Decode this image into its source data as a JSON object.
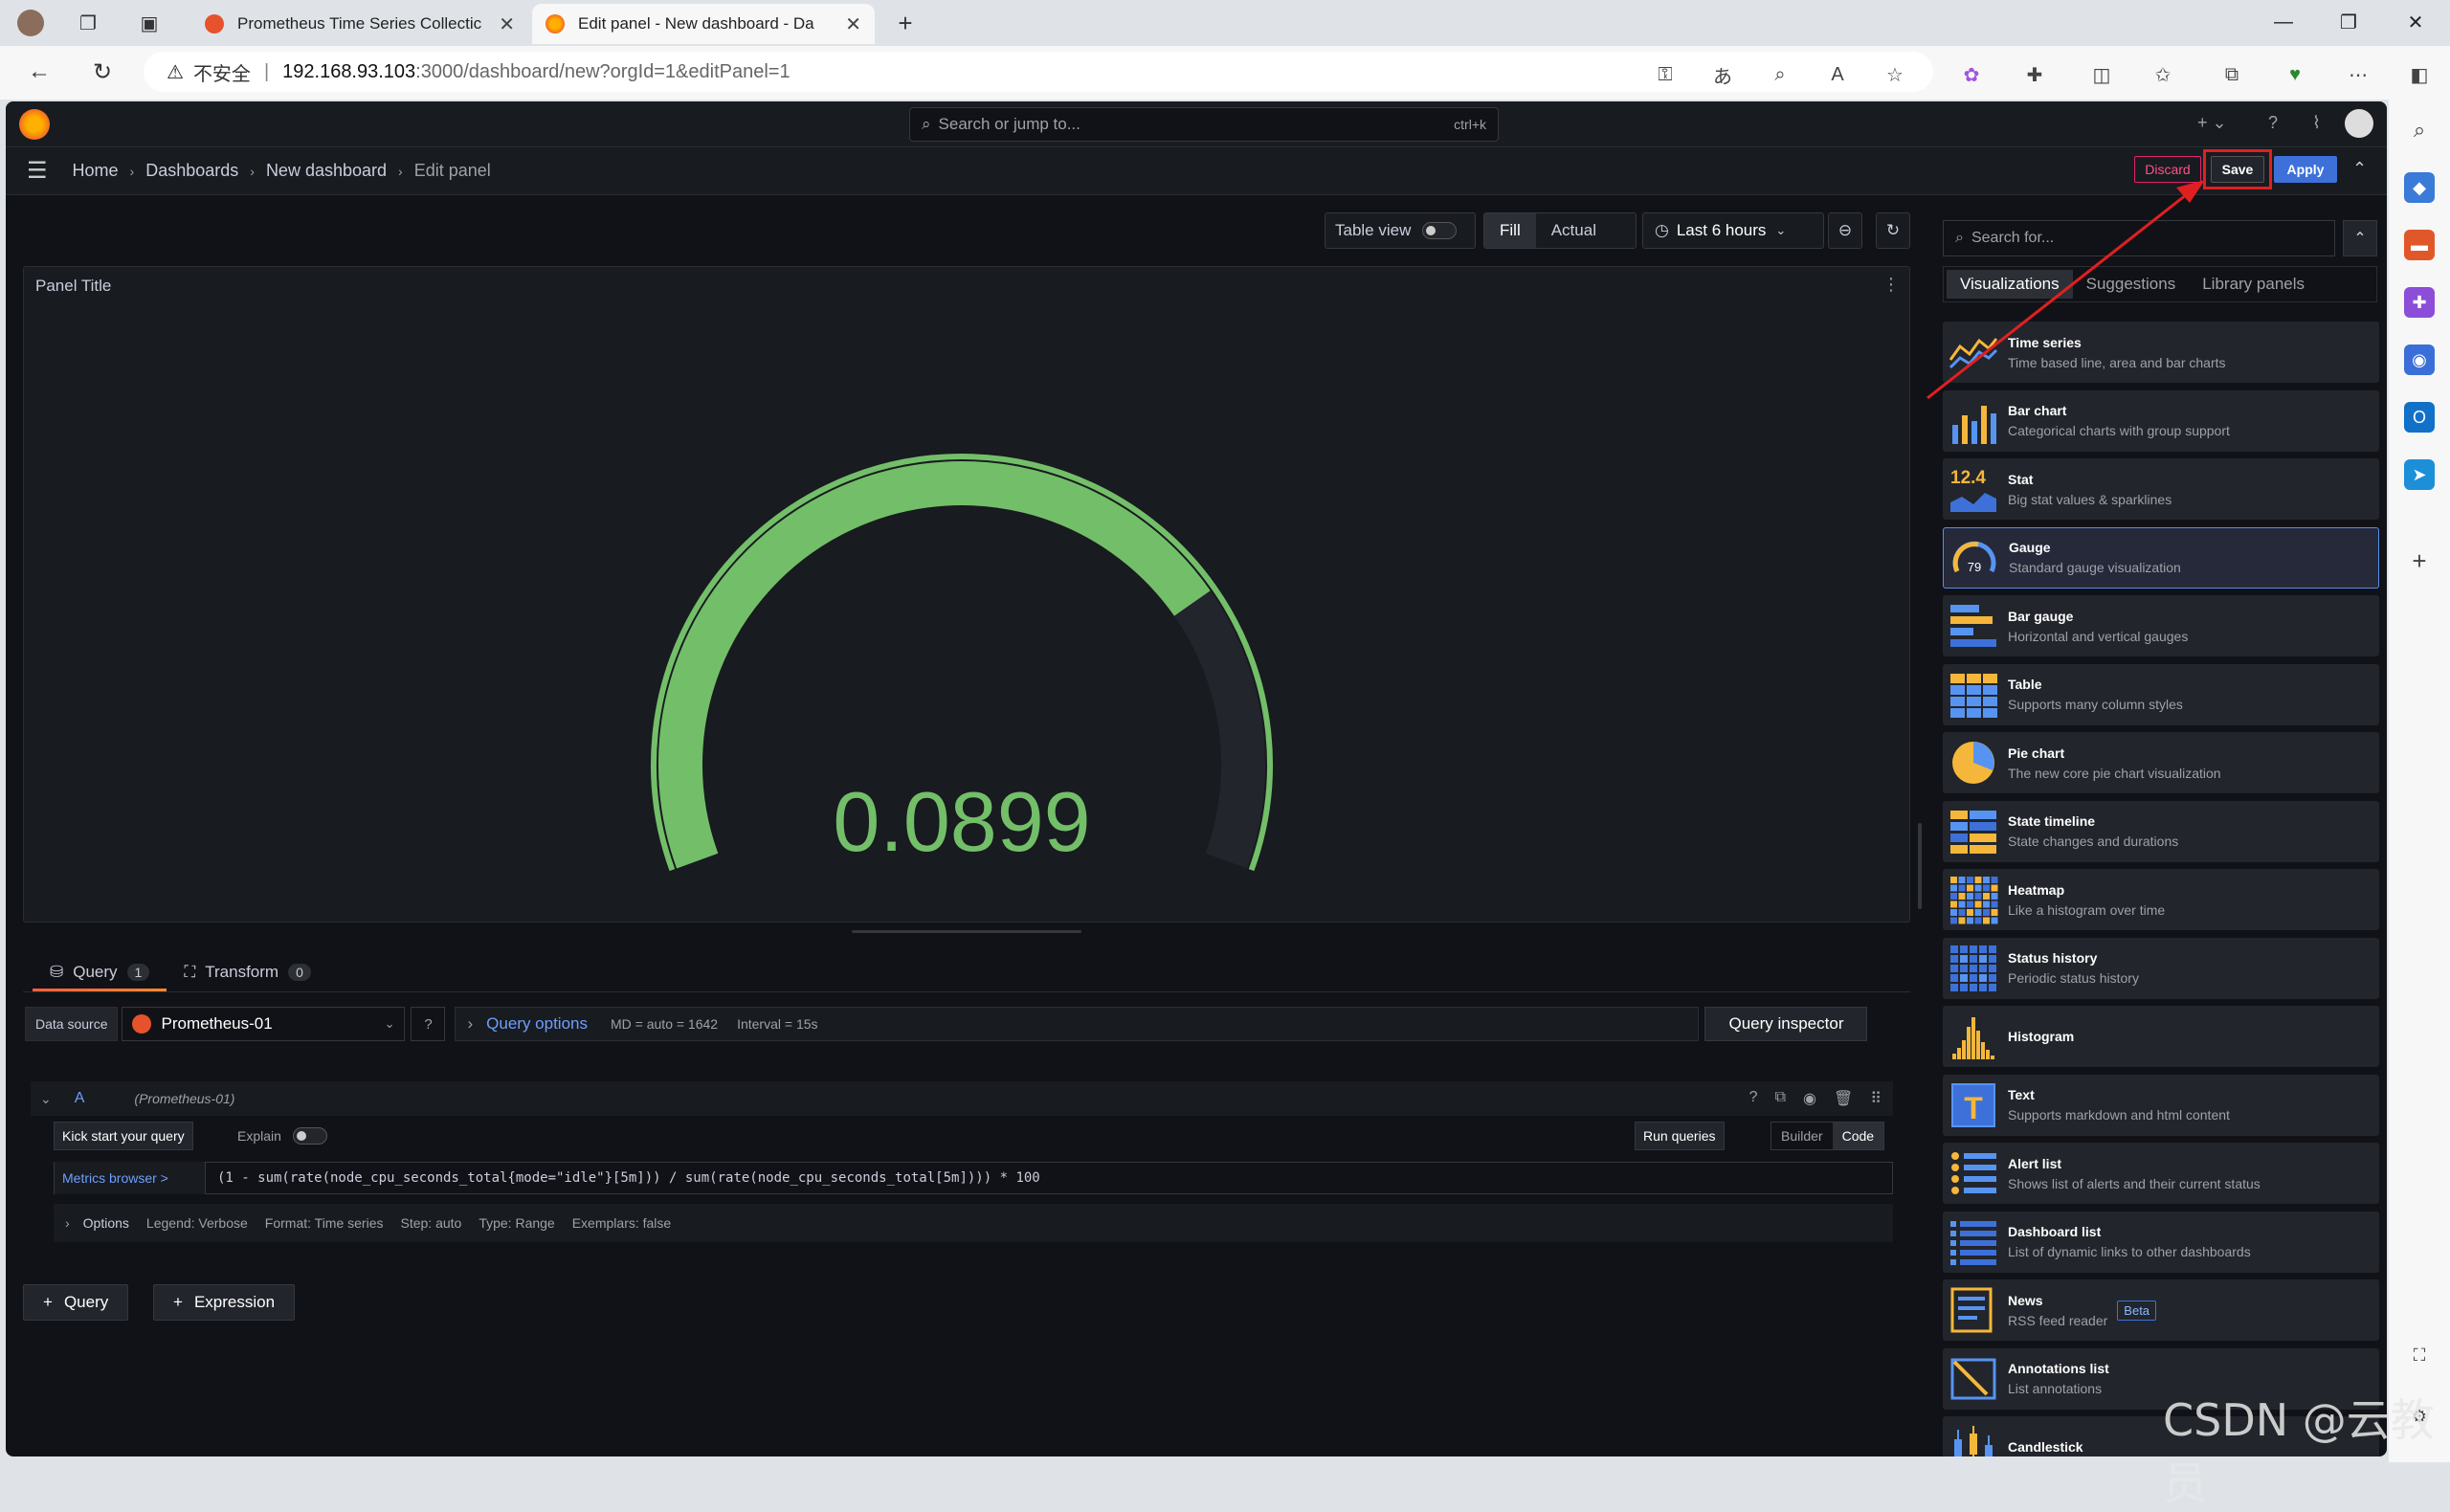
{
  "browser": {
    "tabs": [
      {
        "title": "Prometheus Time Series Collectic"
      },
      {
        "title": "Edit panel - New dashboard - Da"
      }
    ],
    "url": {
      "security": "不安全",
      "host": "192.168.93.103",
      "path": ":3000/dashboard/new?orgId=1&editPanel=1"
    }
  },
  "grafana": {
    "search": {
      "placeholder": "Search or jump to...",
      "shortcut": "ctrl+k"
    },
    "breadcrumb": [
      "Home",
      "Dashboards",
      "New dashboard",
      "Edit panel"
    ],
    "actions": {
      "discard": "Discard",
      "save": "Save",
      "apply": "Apply"
    },
    "toolbar": {
      "table_view": "Table view",
      "fill": "Fill",
      "actual": "Actual",
      "time_range": "Last 6 hours"
    },
    "panel": {
      "title": "Panel Title",
      "value": "0.0899",
      "gauge_fraction": 0.75,
      "gauge_color": "#73bf69"
    },
    "query_tabs": [
      {
        "label": "Query",
        "count": "1"
      },
      {
        "label": "Transform",
        "count": "0"
      }
    ],
    "datasource": {
      "label": "Data source",
      "name": "Prometheus-01"
    },
    "query_options": {
      "label": "Query options",
      "md": "MD = auto = 1642",
      "interval": "Interval = 15s",
      "inspector": "Query inspector"
    },
    "query_a": {
      "ref": "A",
      "ds": "(Prometheus-01)",
      "kick": "Kick start your query",
      "explain": "Explain",
      "run": "Run queries",
      "builder": "Builder",
      "code": "Code",
      "metrics_browser": "Metrics browser >",
      "expr": "(1 - sum(rate(node_cpu_seconds_total{mode=\"idle\"}[5m])) / sum(rate(node_cpu_seconds_total[5m]))) * 100",
      "options": {
        "label": "Options",
        "legend": "Legend: Verbose",
        "format": "Format: Time series",
        "step": "Step: auto",
        "type": "Type: Range",
        "exemplars": "Exemplars: false"
      }
    },
    "add": {
      "query": "Query",
      "expression": "Expression"
    },
    "viz": {
      "search_placeholder": "Search for...",
      "tabs": [
        "Visualizations",
        "Suggestions",
        "Library panels"
      ],
      "items": [
        {
          "name": "Time series",
          "desc": "Time based line, area and bar charts",
          "icon": "time-series-icon"
        },
        {
          "name": "Bar chart",
          "desc": "Categorical charts with group support",
          "icon": "bar-chart-icon"
        },
        {
          "name": "Stat",
          "desc": "Big stat values & sparklines",
          "icon": "stat-icon",
          "icon_text": "12.4"
        },
        {
          "name": "Gauge",
          "desc": "Standard gauge visualization",
          "icon": "gauge-icon",
          "icon_text": "79"
        },
        {
          "name": "Bar gauge",
          "desc": "Horizontal and vertical gauges",
          "icon": "bar-gauge-icon"
        },
        {
          "name": "Table",
          "desc": "Supports many column styles",
          "icon": "table-icon"
        },
        {
          "name": "Pie chart",
          "desc": "The new core pie chart visualization",
          "icon": "pie-chart-icon"
        },
        {
          "name": "State timeline",
          "desc": "State changes and durations",
          "icon": "state-timeline-icon"
        },
        {
          "name": "Heatmap",
          "desc": "Like a histogram over time",
          "icon": "heatmap-icon"
        },
        {
          "name": "Status history",
          "desc": "Periodic status history",
          "icon": "status-history-icon"
        },
        {
          "name": "Histogram",
          "desc": "",
          "icon": "histogram-icon"
        },
        {
          "name": "Text",
          "desc": "Supports markdown and html content",
          "icon": "text-icon",
          "icon_text": "T"
        },
        {
          "name": "Alert list",
          "desc": "Shows list of alerts and their current status",
          "icon": "alert-list-icon"
        },
        {
          "name": "Dashboard list",
          "desc": "List of dynamic links to other dashboards",
          "icon": "dashboard-list-icon"
        },
        {
          "name": "News",
          "desc": "RSS feed reader",
          "icon": "news-icon",
          "badge": "Beta"
        },
        {
          "name": "Annotations list",
          "desc": "List annotations",
          "icon": "annotations-list-icon"
        },
        {
          "name": "Candlestick",
          "desc": "",
          "icon": "candlestick-icon"
        }
      ]
    }
  },
  "watermark": "CSDN @云教员"
}
